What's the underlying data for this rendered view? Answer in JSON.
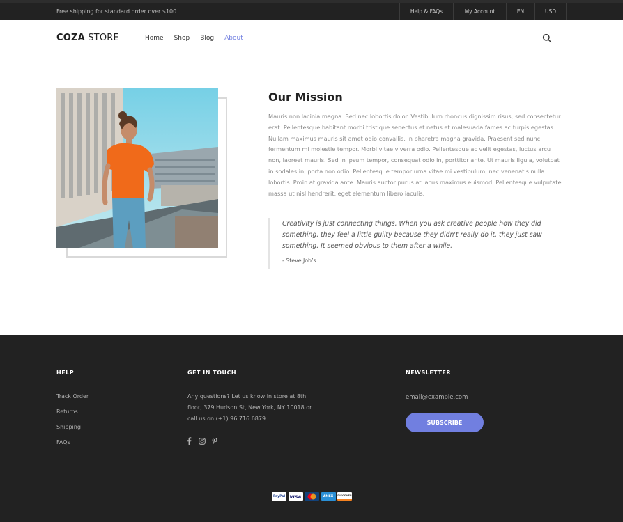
{
  "topbar": {
    "shipping_text": "Free shipping for standard order over $100",
    "links": [
      "Help & FAQs",
      "My Account",
      "EN",
      "USD"
    ]
  },
  "header": {
    "logo_bold": "COZA",
    "logo_light": "STORE",
    "nav": [
      "Home",
      "Shop",
      "Blog",
      "About"
    ],
    "active_nav": "About",
    "accent": "#717fe0"
  },
  "about": {
    "title": "Our Mission",
    "text": "Mauris non lacinia magna. Sed nec lobortis dolor. Vestibulum rhoncus dignissim risus, sed consectetur erat. Pellentesque habitant morbi tristique senectus et netus et malesuada fames ac turpis egestas. Nullam maximus mauris sit amet odio convallis, in pharetra magna gravida. Praesent sed nunc fermentum mi molestie tempor. Morbi vitae viverra odio. Pellentesque ac velit egestas, luctus arcu non, laoreet mauris. Sed in ipsum tempor, consequat odio in, porttitor ante. Ut mauris ligula, volutpat in sodales in, porta non odio. Pellentesque tempor urna vitae mi vestibulum, nec venenatis nulla lobortis. Proin at gravida ante. Mauris auctor purus at lacus maximus euismod. Pellentesque vulputate massa ut nisl hendrerit, eget elementum libero iaculis.",
    "quote": "Creativity is just connecting things. When you ask creative people how they did something, they feel a little guilty because they didn't really do it, they just saw something. It seemed obvious to them after a while.",
    "quote_author": "- Steve Job’s"
  },
  "footer": {
    "help_heading": "HELP",
    "help_links": [
      "Track Order",
      "Returns",
      "Shipping",
      "FAQs"
    ],
    "contact_heading": "GET IN TOUCH",
    "contact_text": "Any questions? Let us know in store at 8th floor, 379 Hudson St, New York, NY 10018 or call us on (+1) 96 716 6879",
    "social_icons": [
      "facebook-icon",
      "instagram-icon",
      "pinterest-icon"
    ],
    "newsletter_heading": "NEWSLETTER",
    "email_placeholder": "email@example.com",
    "subscribe_label": "SUBSCRIBE",
    "payment_cards": [
      "PayPal",
      "VISA",
      "Mastercard",
      "AMEX",
      "DISCOVER"
    ]
  }
}
